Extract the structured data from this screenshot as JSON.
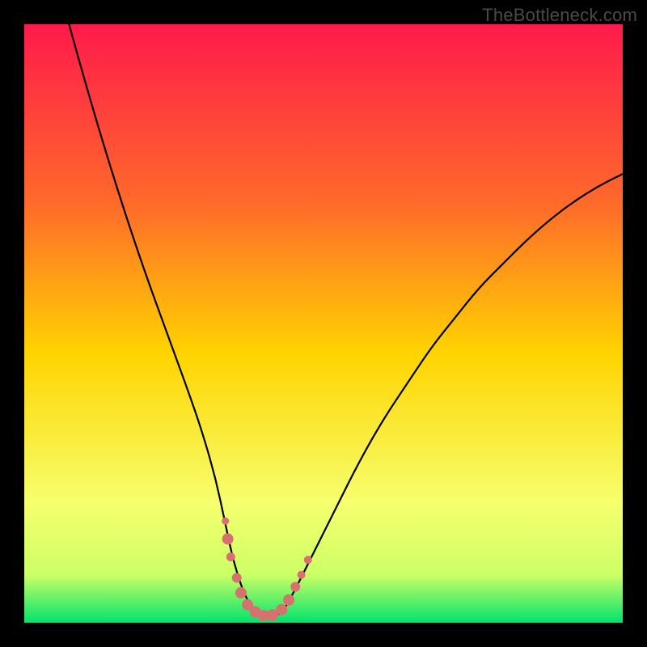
{
  "watermark": "TheBottleneck.com",
  "colors": {
    "frame_bg": "#000000",
    "gradient_top": "#ff1a4b",
    "gradient_mid_upper": "#ff6a2a",
    "gradient_mid": "#ffd400",
    "gradient_low1": "#f6ff6e",
    "gradient_low2": "#ccff66",
    "gradient_bottom": "#00e36b",
    "curve_stroke": "#000000",
    "marker_fill": "#d87070",
    "marker_stroke": "#b85a5a"
  },
  "chart_data": {
    "type": "line",
    "title": "",
    "xlabel": "",
    "ylabel": "",
    "xlim": [
      0,
      100
    ],
    "ylim": [
      0,
      100
    ],
    "grid": false,
    "legend": false,
    "series": [
      {
        "name": "bottleneck-curve",
        "x": [
          0,
          4,
          8,
          12,
          16,
          20,
          24,
          28,
          30,
          32,
          33.5,
          35,
          37,
          39,
          41,
          43,
          45,
          48,
          52,
          56,
          60,
          64,
          68,
          72,
          76,
          80,
          84,
          88,
          92,
          96,
          100
        ],
        "y": [
          130,
          113,
          98,
          84,
          71,
          59,
          48,
          37,
          31,
          24,
          17,
          10,
          4,
          1.5,
          1,
          1.5,
          5,
          11,
          19,
          27,
          34,
          40,
          46,
          51,
          56,
          60,
          64,
          67.5,
          70.5,
          73,
          75
        ]
      }
    ],
    "markers": [
      {
        "x": 33.6,
        "y": 17,
        "r": 4.5
      },
      {
        "x": 34.0,
        "y": 14,
        "r": 7
      },
      {
        "x": 34.5,
        "y": 11,
        "r": 5.5
      },
      {
        "x": 35.5,
        "y": 7.5,
        "r": 6
      },
      {
        "x": 36.2,
        "y": 5.0,
        "r": 7
      },
      {
        "x": 37.3,
        "y": 3.0,
        "r": 7
      },
      {
        "x": 38.6,
        "y": 1.8,
        "r": 7
      },
      {
        "x": 40.0,
        "y": 1.2,
        "r": 7
      },
      {
        "x": 41.5,
        "y": 1.3,
        "r": 7
      },
      {
        "x": 43.0,
        "y": 2.2,
        "r": 7
      },
      {
        "x": 44.2,
        "y": 3.8,
        "r": 7
      },
      {
        "x": 45.3,
        "y": 6.0,
        "r": 6
      },
      {
        "x": 46.3,
        "y": 8.0,
        "r": 5
      },
      {
        "x": 47.4,
        "y": 10.5,
        "r": 5
      }
    ]
  }
}
